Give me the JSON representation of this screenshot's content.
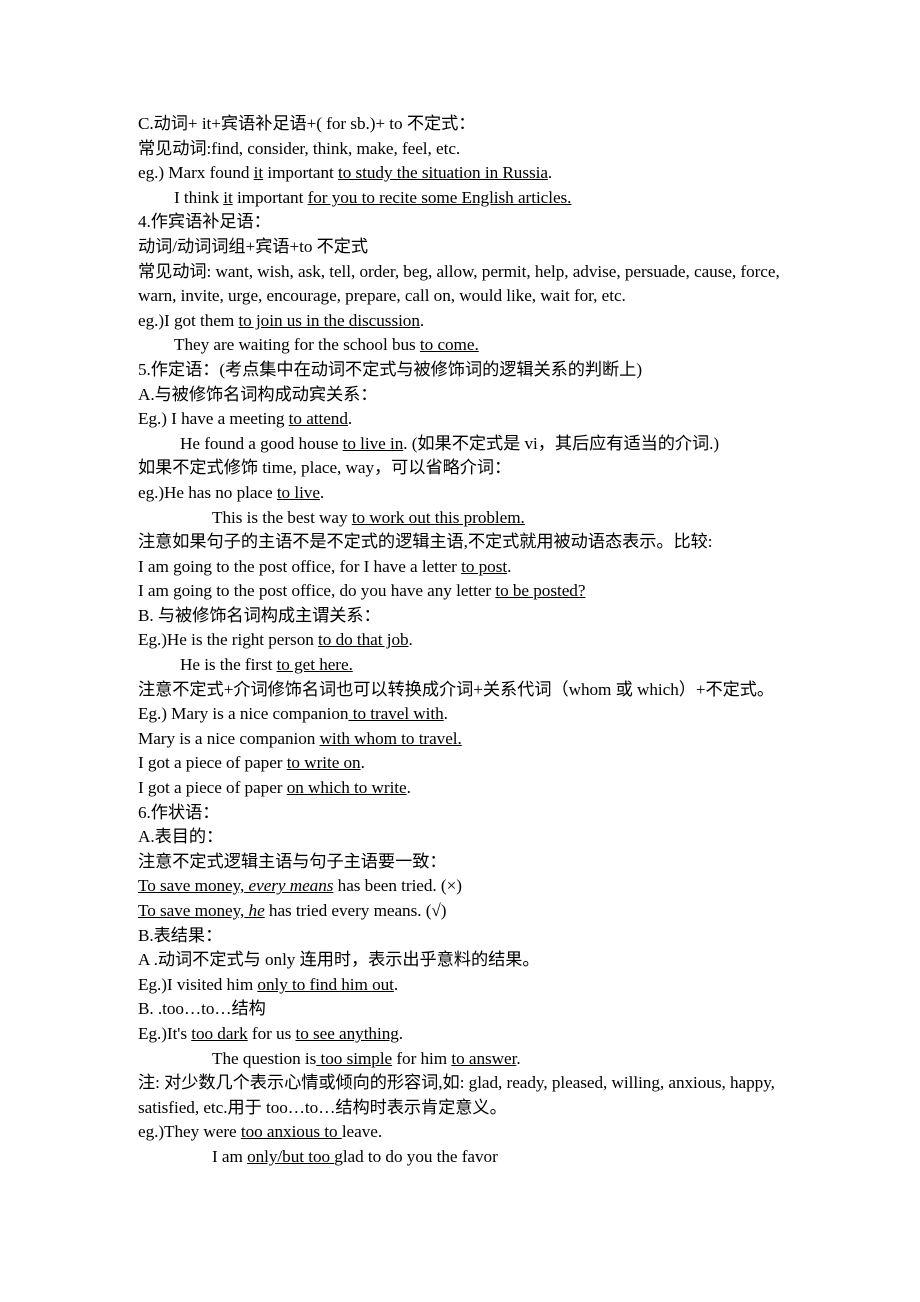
{
  "document": {
    "type": "grammar-notes",
    "language": "zh-CN + en",
    "topic": "英语动词不定式用法",
    "lines": [
      {
        "id": "l01",
        "text": "C.动词+ it+宾语补足语+( for sb.)+ to 不定式："
      },
      {
        "id": "l02",
        "text": "常见动词:find, consider, think, make, feel, etc."
      },
      {
        "id": "l03",
        "pre": "eg.) Marx found ",
        "u1": "it",
        "mid": " important ",
        "u2": "to study the situation in Russia",
        "post": "."
      },
      {
        "id": "l04",
        "indent": "ind1",
        "pre": "I think ",
        "u1": "it",
        "mid": " important ",
        "u2": "for you to recite some English articles.",
        "post": ""
      },
      {
        "id": "l05",
        "text": "4.作宾语补足语："
      },
      {
        "id": "l06",
        "text": "动词/动词词组+宾语+to 不定式"
      },
      {
        "id": "l07",
        "text": "常见动词: want, wish, ask, tell, order, beg, allow, permit, help, advise, persuade, cause, force, warn, invite, urge, encourage, prepare, call on, would like, wait for, etc."
      },
      {
        "id": "l08",
        "pre": "eg.)I got them ",
        "u1": "to join us in the discussion",
        "post": "."
      },
      {
        "id": "l09",
        "indent": "ind1",
        "pre": "They are waiting for the school bus ",
        "u1": "to come.",
        "post": ""
      },
      {
        "id": "l10",
        "text": "5.作定语：(考点集中在动词不定式与被修饰词的逻辑关系的判断上)"
      },
      {
        "id": "l11",
        "text": "A.与被修饰名词构成动宾关系："
      },
      {
        "id": "l12",
        "pre": "Eg.) I have a meeting ",
        "u1": "to attend",
        "post": "."
      },
      {
        "id": "l13",
        "indent": "ind2",
        "pre": "He found a good house ",
        "u1": "to live in",
        "post": ". (如果不定式是 vi，其后应有适当的介词.)"
      },
      {
        "id": "l14",
        "text": "如果不定式修饰 time, place, way，可以省略介词："
      },
      {
        "id": "l15",
        "pre": "eg.)He has no place ",
        "u1": " to live",
        "post": "."
      },
      {
        "id": "l16",
        "indent": "ind3",
        "pre": "This is the best way ",
        "u1": "to work out this problem.",
        "post": ""
      },
      {
        "id": "l17",
        "text": "注意如果句子的主语不是不定式的逻辑主语,不定式就用被动语态表示。比较:"
      },
      {
        "id": "l18",
        "pre": "I am going to the post office, for I have a letter ",
        "u1": "to post",
        "post": "."
      },
      {
        "id": "l19",
        "pre": "I am going to the post office, do you have any letter ",
        "u1": "to be posted?",
        "post": ""
      },
      {
        "id": "l20",
        "text": "B. 与被修饰名词构成主谓关系："
      },
      {
        "id": "l21",
        "pre": "Eg.)He is the right person ",
        "u1": "to do that job",
        "post": "."
      },
      {
        "id": "l22",
        "indent": "ind2",
        "pre": "He is the first ",
        "u1": "to get here.",
        "post": ""
      },
      {
        "id": "l23",
        "text": "注意不定式+介词修饰名词也可以转换成介词+关系代词（whom 或 which）+不定式。"
      },
      {
        "id": "l24",
        "pre": "Eg.) Mary is a nice companion",
        "u1": " to travel with",
        "post": "."
      },
      {
        "id": "l25",
        "pre": "Mary is a nice companion ",
        "u1": "with whom to travel.",
        "post": ""
      },
      {
        "id": "l26",
        "pre": "I got a piece of paper ",
        "u1": "to write on",
        "post": "."
      },
      {
        "id": "l27",
        "pre": "I got a piece of paper ",
        "u1": "on which to write",
        "post": "."
      },
      {
        "id": "l28",
        "text": "6.作状语："
      },
      {
        "id": "l29",
        "text": "A.表目的："
      },
      {
        "id": "l30",
        "text": "注意不定式逻辑主语与句子主语要一致："
      },
      {
        "id": "l31",
        "u1": "To save money,",
        "italic_u": " every means",
        "post": " has been tried. (×)"
      },
      {
        "id": "l32",
        "u1": "To save money,",
        "italic_u": " he",
        "post": " has tried every means. (√)"
      },
      {
        "id": "l33",
        "text": "B.表结果："
      },
      {
        "id": "l34",
        "text": "A .动词不定式与 only 连用时，表示出乎意料的结果。"
      },
      {
        "id": "l35",
        "pre": "Eg.)I visited him ",
        "u1": "only to find him out",
        "post": "."
      },
      {
        "id": "l36",
        "text": "B. .too…to…结构"
      },
      {
        "id": "l37",
        "pre": "Eg.)It's ",
        "u1": "too dark",
        "mid": " for us ",
        "u2": "to see anything",
        "post": "."
      },
      {
        "id": "l38",
        "indent": "ind3",
        "pre": "The question is",
        "u1": " too simple",
        "mid": " for him ",
        "u2": "to answer",
        "post": "."
      },
      {
        "id": "l39",
        "text": "注: 对少数几个表示心情或倾向的形容词,如: glad, ready, pleased, willing, anxious, happy, satisfied, etc.用于 too…to…结构时表示肯定意义。"
      },
      {
        "id": "l40",
        "pre": "eg.)They were ",
        "u1": "too anxious to ",
        "post": "leave."
      },
      {
        "id": "l41",
        "indent": "ind3",
        "pre": "I am ",
        "u1": "only/but too ",
        "post": "glad to do you the favor"
      }
    ]
  }
}
